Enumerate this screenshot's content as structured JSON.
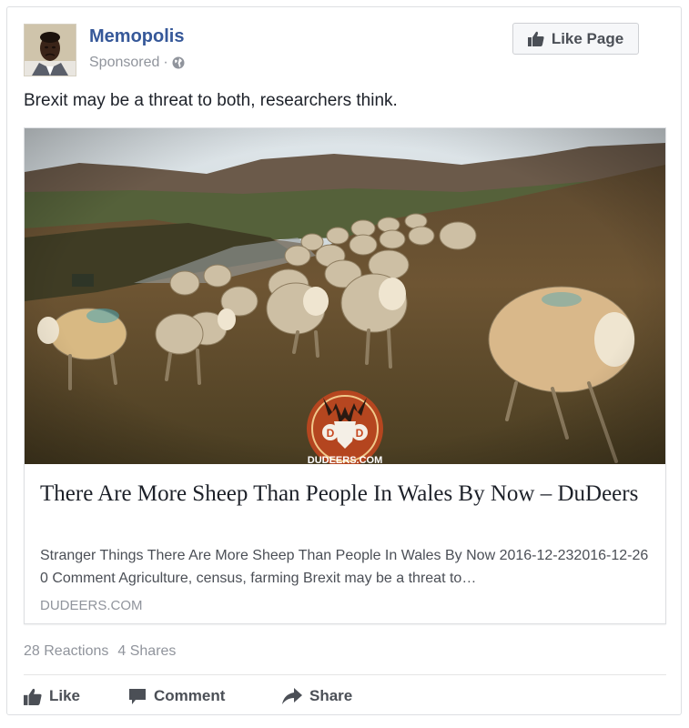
{
  "post": {
    "page_name": "Memopolis",
    "sponsored_label": "Sponsored",
    "separator": "·",
    "audience_icon": "globe-icon",
    "like_page_label": "Like Page",
    "text": "Brexit may be a threat to both, researchers think."
  },
  "link": {
    "image_description_icon": "sheep-photo",
    "watermark_letters": [
      "D",
      "D"
    ],
    "watermark_text": "DUDEERS.COM",
    "title": "There Are More Sheep Than People In Wales By Now – DuDeers",
    "description": "Stranger Things There Are More Sheep Than People In Wales By Now 2016-12-232016-12-26 0 Comment Agriculture, census, farming Brexit may be a threat to…",
    "domain": "DUDEERS.COM"
  },
  "stats": {
    "reactions": "28 Reactions",
    "shares": "4 Shares"
  },
  "actions": {
    "like": "Like",
    "comment": "Comment",
    "share": "Share"
  },
  "colors": {
    "brand_link": "#365899",
    "secondary_text": "#90949c",
    "action_text": "#4b4f56"
  }
}
